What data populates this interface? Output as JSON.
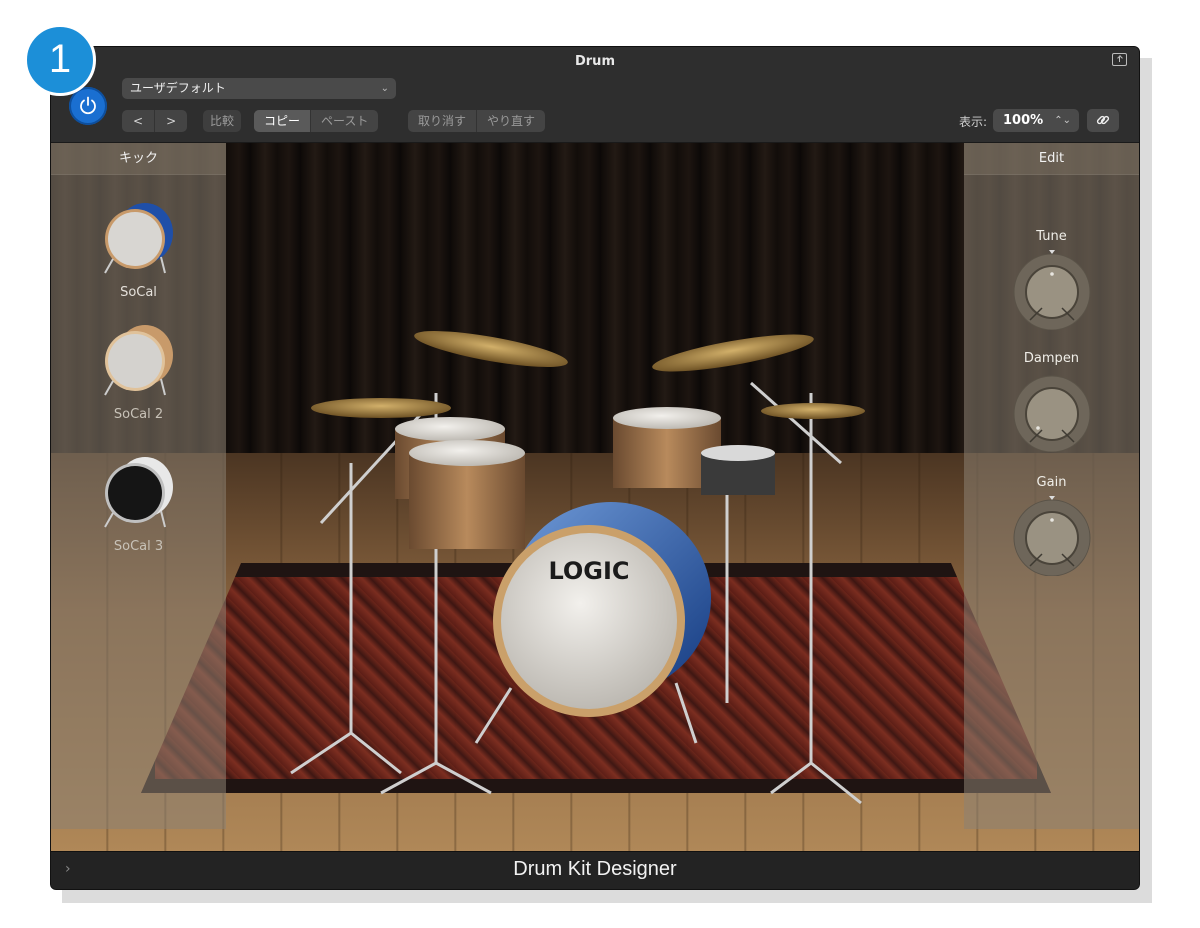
{
  "step_badge": "1",
  "window": {
    "title": "Drum"
  },
  "toolbar": {
    "preset": "ユーザデフォルト",
    "prev_label": "<",
    "next_label": ">",
    "compare_label": "比較",
    "copy_label": "コピー",
    "paste_label": "ペースト",
    "undo_label": "取り消す",
    "redo_label": "やり直す",
    "view_label": "表示:",
    "zoom_value": "100%"
  },
  "left_panel": {
    "title": "キック",
    "kicks": [
      {
        "label": "SoCal",
        "color": "#1f4fa8"
      },
      {
        "label": "SoCal 2",
        "color": "#c89a6a"
      },
      {
        "label": "SoCal 3",
        "color": "#d8d8d8"
      }
    ]
  },
  "right_panel": {
    "title": "Edit",
    "knobs": [
      {
        "label": "Tune",
        "value": 0.5
      },
      {
        "label": "Dampen",
        "value": 0.05
      },
      {
        "label": "Gain",
        "value": 0.5
      }
    ]
  },
  "stage": {
    "bass_drum_logo": "LOGIC"
  },
  "footer": {
    "title": "Drum Kit Designer"
  }
}
